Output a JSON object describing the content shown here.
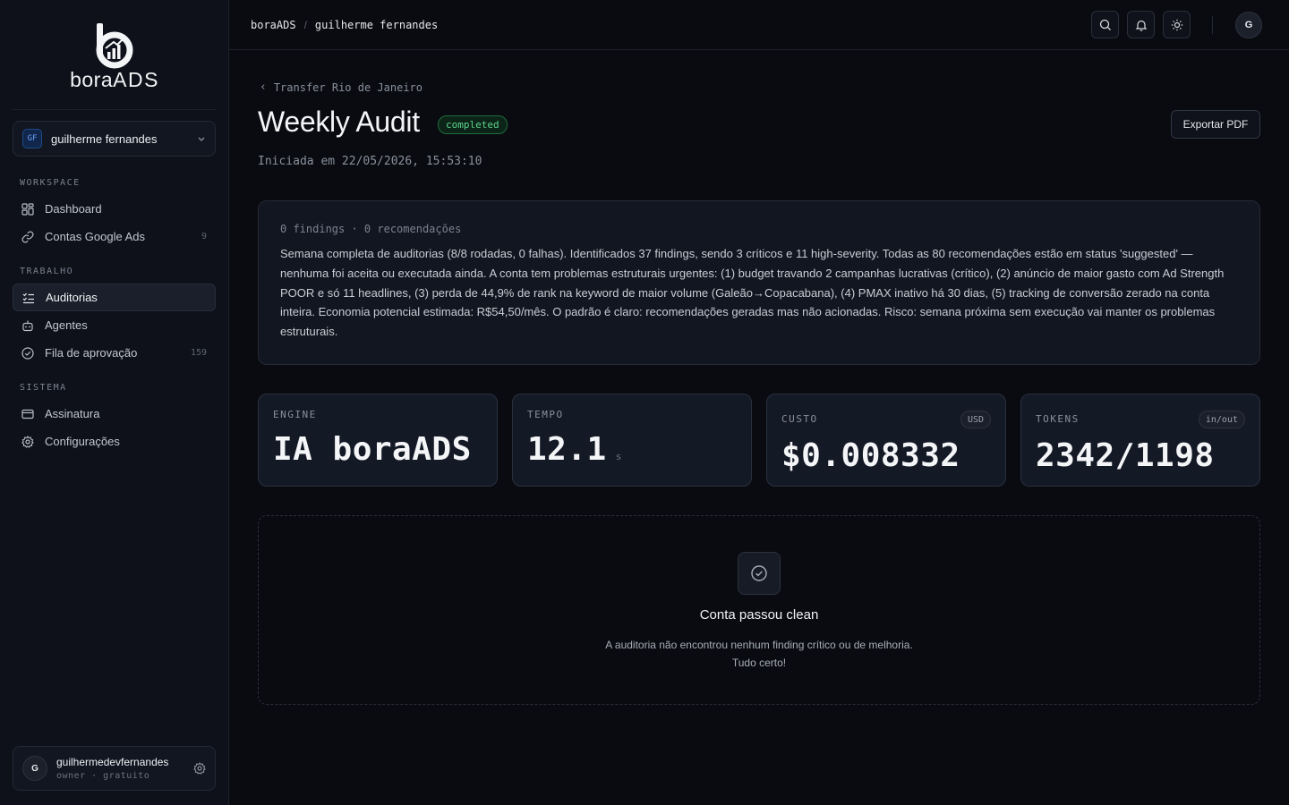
{
  "brand": {
    "logo_text": "bora",
    "logo_text_strong": "ADS"
  },
  "sidebar": {
    "account": {
      "initials": "GF",
      "name": "guilherme fernandes"
    },
    "sections": {
      "workspace": "WORKSPACE",
      "trabalho": "TRABALHO",
      "sistema": "SISTEMA"
    },
    "items": [
      {
        "label": "Dashboard",
        "icon": "grid-icon",
        "count": ""
      },
      {
        "label": "Contas Google Ads",
        "icon": "link-icon",
        "count": "9"
      },
      {
        "label": "Auditorias",
        "icon": "list-check-icon",
        "count": "",
        "active": true
      },
      {
        "label": "Agentes",
        "icon": "bot-icon",
        "count": ""
      },
      {
        "label": "Fila de aprovação",
        "icon": "check-circle-icon",
        "count": "159"
      },
      {
        "label": "Assinatura",
        "icon": "credit-card-icon",
        "count": ""
      },
      {
        "label": "Configurações",
        "icon": "gear-icon",
        "count": ""
      }
    ],
    "user": {
      "initial": "G",
      "name": "guilhermedevfernandes",
      "role": "owner · gratuito"
    }
  },
  "topbar": {
    "breadcrumb": [
      "boraADS",
      "guilherme fernandes"
    ],
    "avatar_initial": "G"
  },
  "page": {
    "back_label": "Transfer Rio de Janeiro",
    "title": "Weekly Audit",
    "status": "completed",
    "started": "Iniciada em 22/05/2026, 15:53:10",
    "export_label": "Exportar PDF"
  },
  "summary": {
    "meta": "0 findings · 0 recomendações",
    "text": "Semana completa de auditorias (8/8 rodadas, 0 falhas). Identificados 37 findings, sendo 3 críticos e 11 high-severity. Todas as 80 recomendações estão em status 'suggested' — nenhuma foi aceita ou executada ainda. A conta tem problemas estruturais urgentes: (1) budget travando 2 campanhas lucrativas (crítico), (2) anúncio de maior gasto com Ad Strength POOR e só 11 headlines, (3) perda de 44,9% de rank na keyword de maior volume (Galeão→Copacabana), (4) PMAX inativo há 30 dias, (5) tracking de conversão zerado na conta inteira. Economia potencial estimada: R$54,50/mês. O padrão é claro: recomendações geradas mas não acionadas. Risco: semana próxima sem execução vai manter os problemas estruturais."
  },
  "metrics": {
    "engine": {
      "label": "ENGINE",
      "value": "IA boraADS"
    },
    "tempo": {
      "label": "TEMPO",
      "value": "12.1",
      "unit": "s"
    },
    "custo": {
      "label": "CUSTO",
      "value": "$0.008332",
      "pill": "USD"
    },
    "tokens": {
      "label": "TOKENS",
      "value": "2342/1198",
      "pill": "in/out"
    }
  },
  "clean": {
    "title": "Conta passou clean",
    "desc_line1": "A auditoria não encontrou nenhum finding crítico ou de melhoria.",
    "desc_line2": "Tudo certo!"
  }
}
